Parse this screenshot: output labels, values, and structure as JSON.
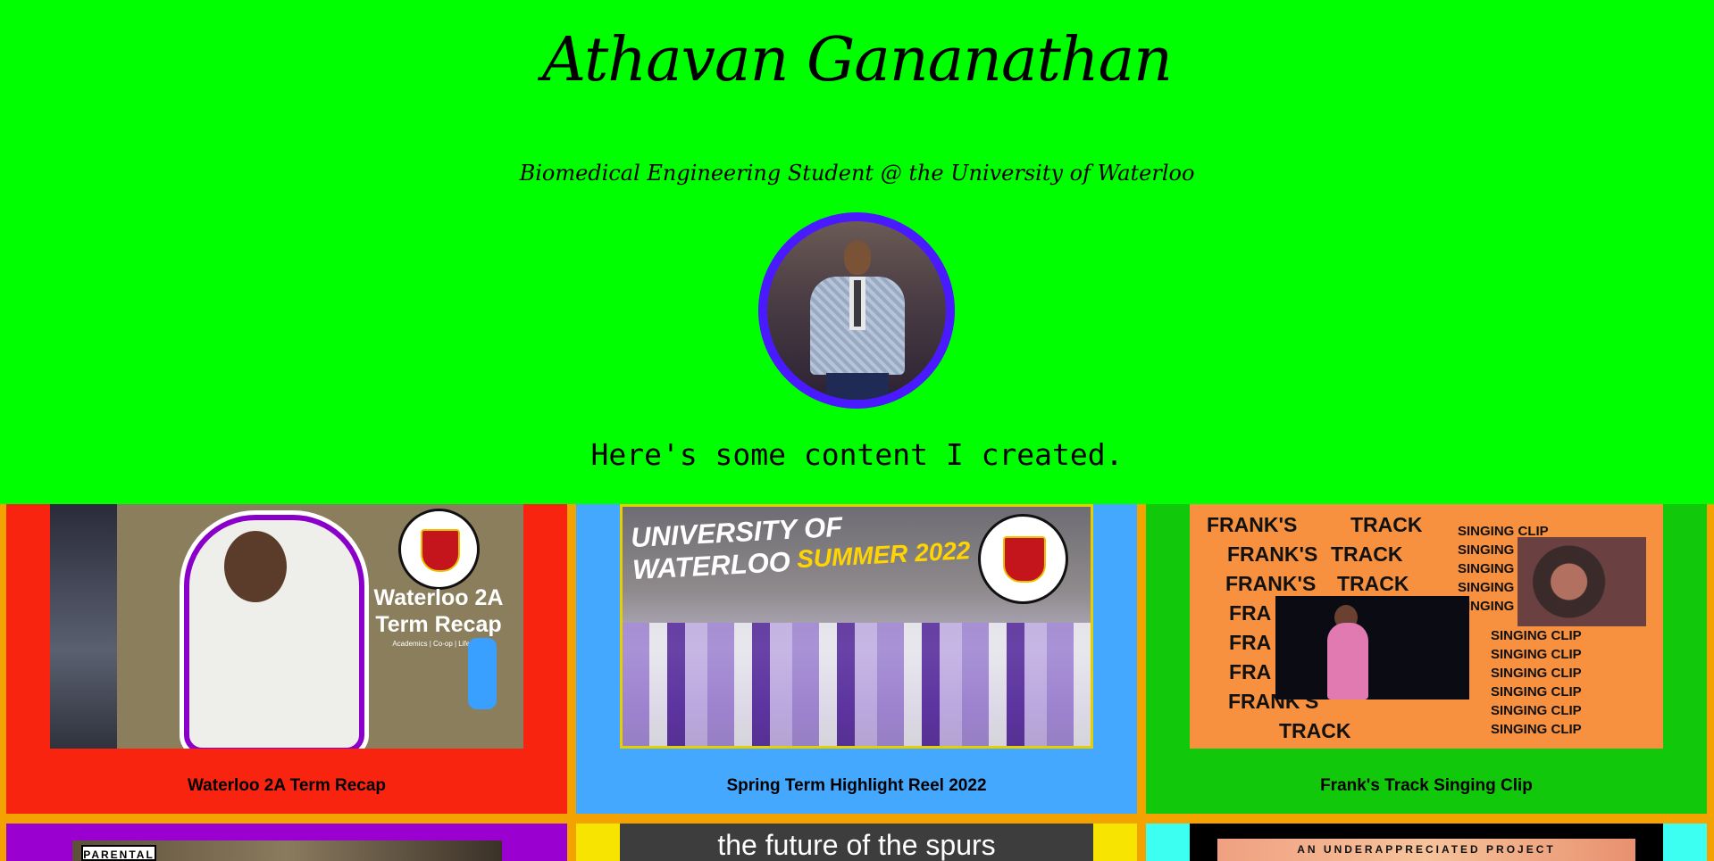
{
  "header": {
    "name": "Athavan Gananathan",
    "subtitle": "Biomedical Engineering Student @ the University of Waterloo",
    "tagline": "Here's some content I created."
  },
  "colors": {
    "header_bg": "#00ff00",
    "avatar_ring": "#4a1aff",
    "grid_bg": "#f4a200",
    "card1_bg": "#f92410",
    "card2_bg": "#44a8ff",
    "card3_bg": "#12c80a",
    "card4_bg": "#9a00d0",
    "card5_bg": "#f7e400",
    "card6_bg": "#3cfff2"
  },
  "cards": [
    {
      "title": "Waterloo 2A Term Recap",
      "thumb_title": "Waterloo 2A Term Recap",
      "thumb_sub": "Academics | Co-op | Lifestyle"
    },
    {
      "title": "Spring Term Highlight Reel 2022",
      "thumb_banner": "UNIVERSITY OF WATERLOO",
      "thumb_summer": "SUMMER 2022"
    },
    {
      "title": "Frank's Track Singing Clip",
      "franks": "FRANK'S",
      "track": "TRACK",
      "singing_clip": "SINGING CLIP",
      "singing": "SINGING",
      "fra": "FRA"
    }
  ],
  "bottom_row": {
    "parental": "PARENTAL",
    "spurs": "the future of the spurs",
    "project": "AN UNDERAPPRECIATED PROJECT"
  }
}
